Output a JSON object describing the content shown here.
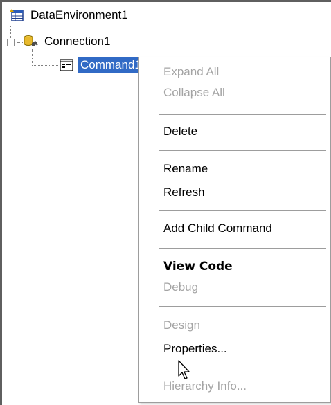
{
  "tree": {
    "root_label": "DataEnvironment1",
    "connection_label": "Connection1",
    "command_label": "Command1",
    "expander_glyph": "−"
  },
  "context_menu": {
    "items": [
      {
        "label": "Expand All",
        "state": "disabled"
      },
      {
        "label": "Collapse All",
        "state": "disabled"
      },
      {
        "label": "Delete",
        "state": "enabled"
      },
      {
        "label": "Rename",
        "state": "enabled"
      },
      {
        "label": "Refresh",
        "state": "enabled"
      },
      {
        "label": "Add Child Command",
        "state": "enabled"
      },
      {
        "label": "View Code",
        "state": "default"
      },
      {
        "label": "Debug",
        "state": "disabled"
      },
      {
        "label": "Design",
        "state": "disabled"
      },
      {
        "label": "Properties...",
        "state": "enabled"
      },
      {
        "label": "Hierarchy Info...",
        "state": "disabled"
      }
    ]
  },
  "colors": {
    "selection": "#316ac5",
    "disabled_text": "#a4a4a4"
  }
}
